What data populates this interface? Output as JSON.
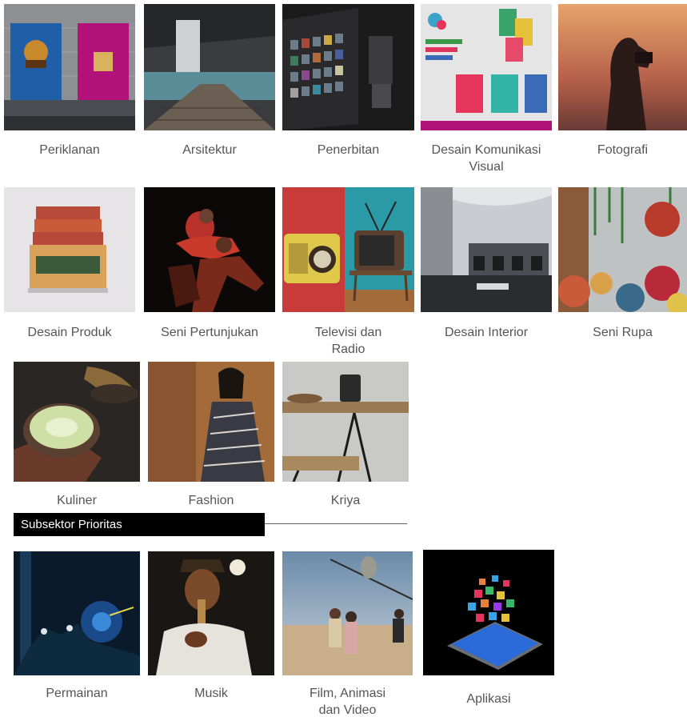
{
  "categories": [
    {
      "label": "Periklanan",
      "image": "advertising-posters-image"
    },
    {
      "label": "Arsitektur",
      "image": "architecture-pool-image"
    },
    {
      "label": "Penerbitan",
      "image": "bookstore-image"
    },
    {
      "label": "Desain Komunikasi\nVisual",
      "image": "poster-design-image"
    },
    {
      "label": "Fotografi",
      "image": "photographer-silhouette-image"
    },
    {
      "label": "Desain Produk",
      "image": "packaging-product-image"
    },
    {
      "label": "Seni Pertunjukan",
      "image": "dancers-image"
    },
    {
      "label": "Televisi dan\nRadio",
      "image": "radio-television-image"
    },
    {
      "label": "Desain Interior",
      "image": "interior-room-image"
    },
    {
      "label": "Seni Rupa",
      "image": "art-installation-image"
    },
    {
      "label": "Kuliner",
      "image": "matcha-latte-image"
    },
    {
      "label": "Fashion",
      "image": "fashion-model-image"
    },
    {
      "label": "Kriya",
      "image": "wooden-table-image"
    }
  ],
  "priority": {
    "heading": "Subsektor Prioritas",
    "items": [
      {
        "label": "Permainan",
        "image": "game-scene-image"
      },
      {
        "label": "Musik",
        "image": "flute-player-image"
      },
      {
        "label": "Film, Animasi\ndan Video",
        "image": "film-shooting-image"
      },
      {
        "label": "Aplikasi",
        "image": "smartphone-apps-image"
      }
    ]
  },
  "colors": {
    "caption": "#555555",
    "banner_bg": "#000000",
    "banner_text": "#ffffff"
  }
}
